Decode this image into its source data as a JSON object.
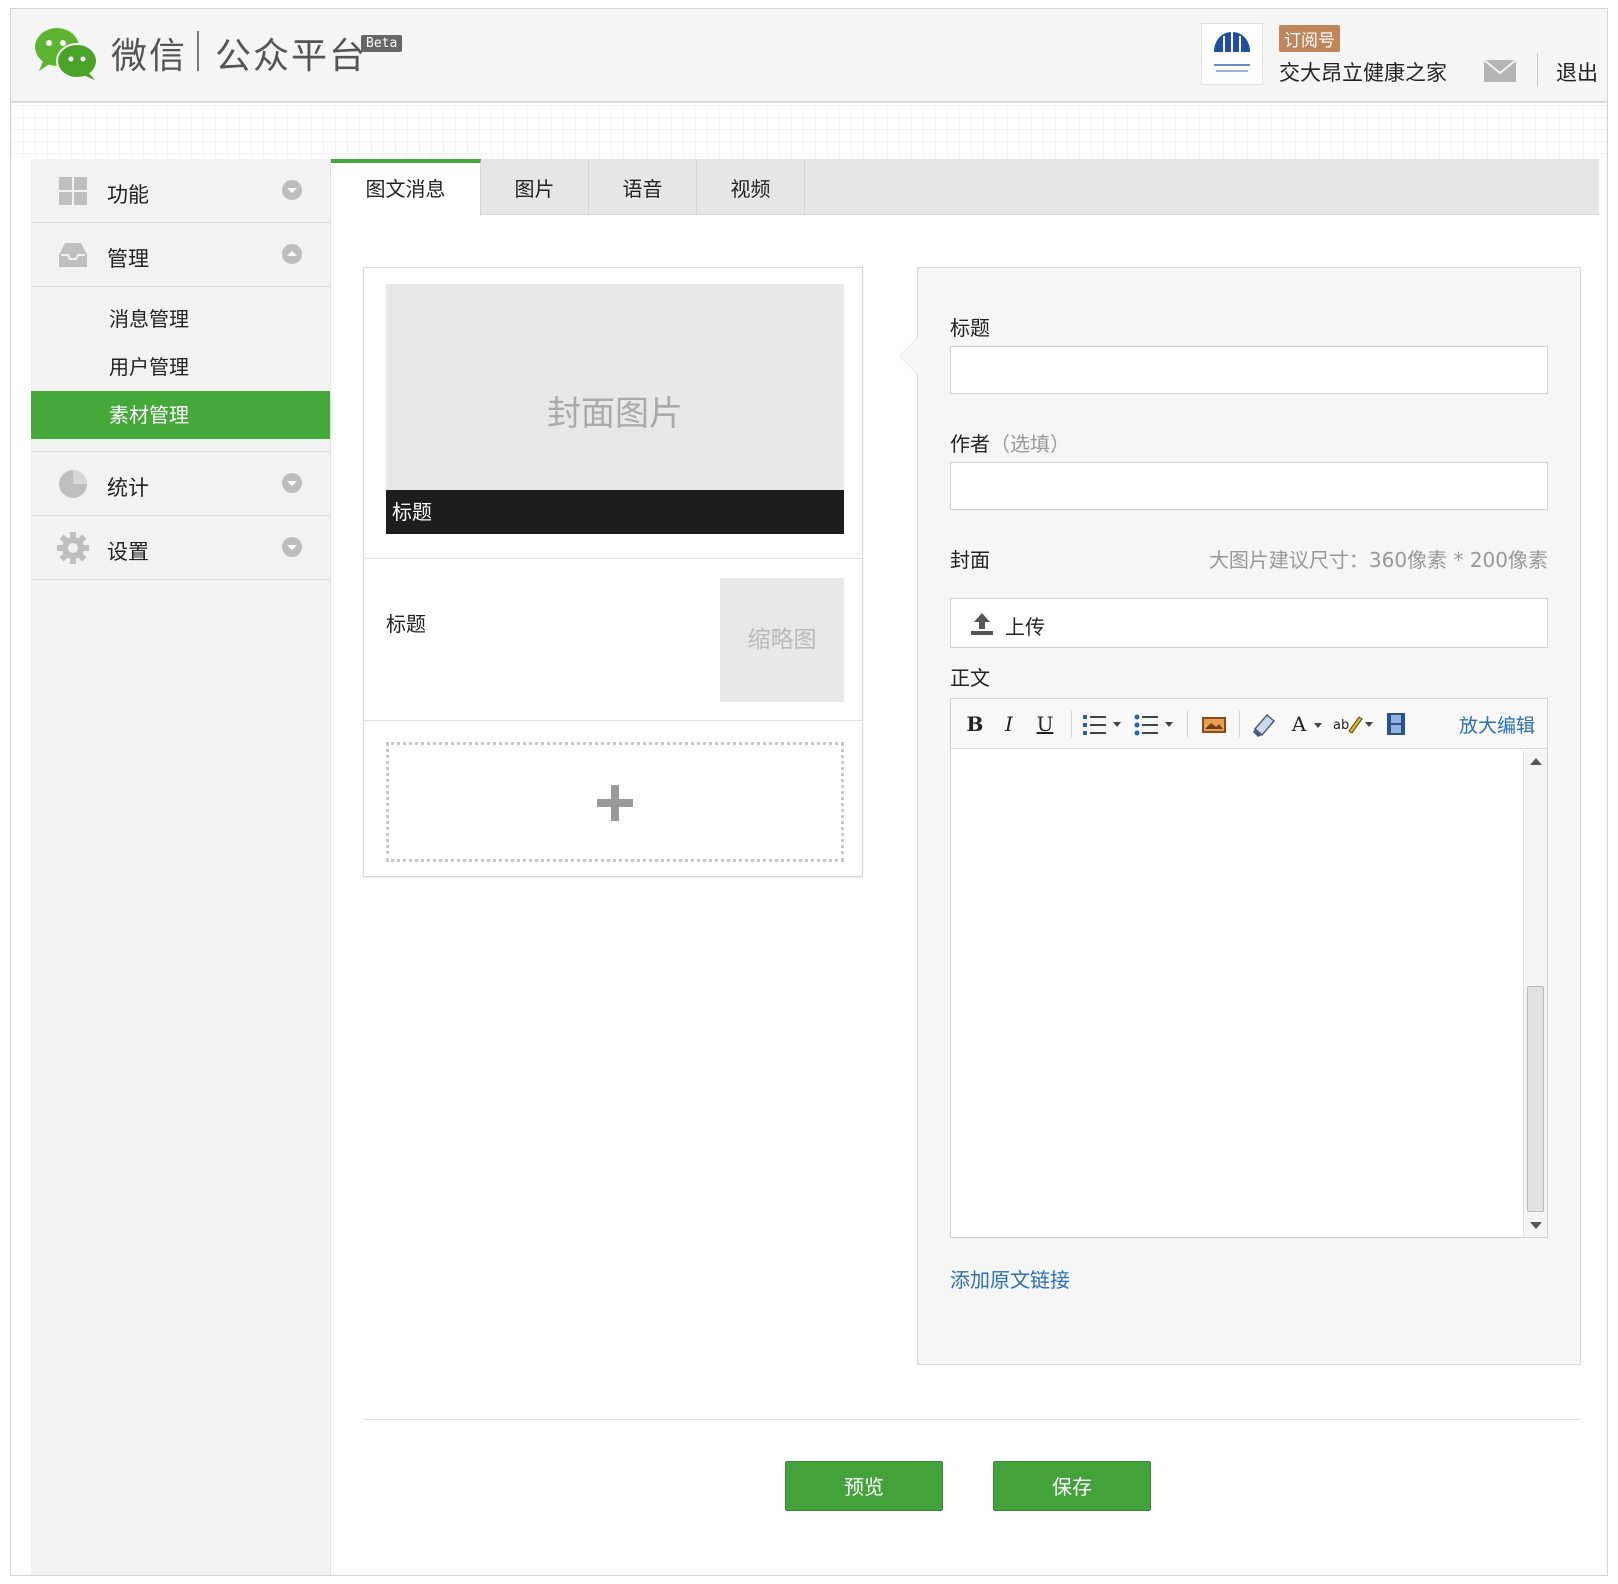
{
  "header": {
    "brand_wechat": "微信",
    "brand_platform": "公众平台",
    "beta_badge": "Beta",
    "account_type": "订阅号",
    "account_name": "交大昂立健康之家",
    "logout": "退出",
    "mail_icon": "mail-icon"
  },
  "sidebar": {
    "groups": [
      {
        "label": "功能",
        "icon": "grid-icon"
      },
      {
        "label": "管理",
        "icon": "inbox-icon"
      },
      {
        "label": "统计",
        "icon": "pie-chart-icon"
      },
      {
        "label": "设置",
        "icon": "gear-icon"
      }
    ],
    "manage_items": [
      {
        "label": "消息管理",
        "active": false
      },
      {
        "label": "用户管理",
        "active": false
      },
      {
        "label": "素材管理",
        "active": true
      }
    ]
  },
  "tabs": [
    {
      "label": "图文消息",
      "active": true
    },
    {
      "label": "图片",
      "active": false
    },
    {
      "label": "语音",
      "active": false
    },
    {
      "label": "视频",
      "active": false
    }
  ],
  "preview": {
    "cover_placeholder": "封面图片",
    "cover_title": "标题",
    "item_title": "标题",
    "thumbnail_placeholder": "缩略图",
    "add_icon": "plus-icon"
  },
  "form": {
    "title_label": "标题",
    "title_value": "",
    "author_label": "作者",
    "author_optional": "（选填）",
    "author_value": "",
    "cover_label": "封面",
    "cover_hint": "大图片建议尺寸：360像素 * 200像素",
    "upload_label": "上传",
    "body_label": "正文",
    "toolbar": {
      "bold": "B",
      "italic": "I",
      "underline": "U",
      "font_color": "A",
      "zoom_edit": "放大编辑"
    },
    "add_source_link": "添加原文链接"
  },
  "actions": {
    "preview": "预览",
    "save": "保存"
  },
  "colors": {
    "accent_green": "#44a83b",
    "link_blue": "#2a6fb8",
    "badge_brown": "#c0855b"
  }
}
